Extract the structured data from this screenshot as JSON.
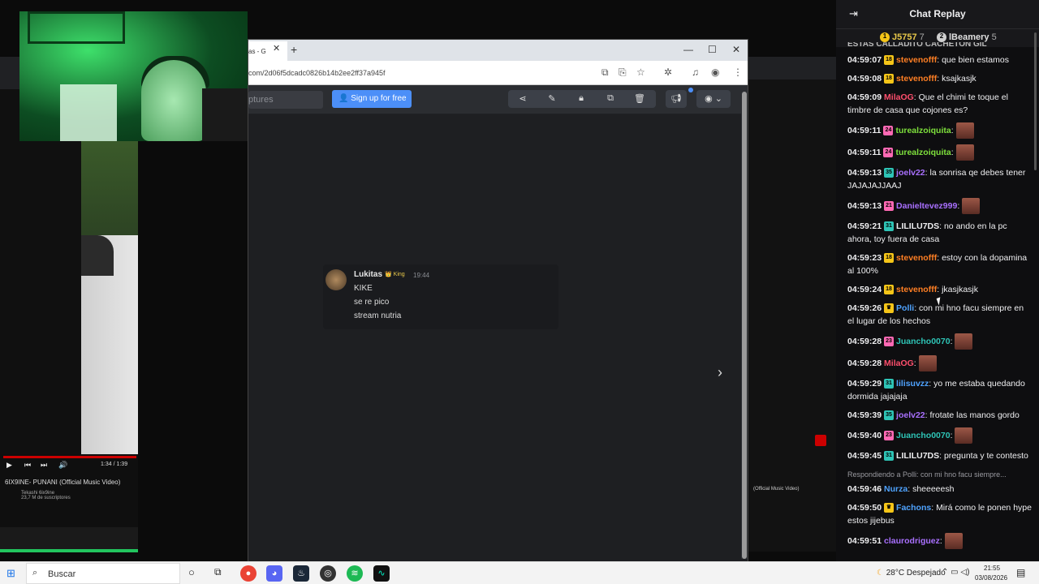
{
  "stream": {
    "left_video": {
      "title": "6IX9INE- PUNANI (Official Music Video)",
      "channel": "Tekashi 6ix9ine",
      "subs": "23,7 M de suscriptores",
      "time": "1:34 / 1:39"
    },
    "right_video": {
      "title": "(Official Music Video)"
    }
  },
  "browser": {
    "tab_title": "as - G",
    "url": "com/2d06f5dcadc0826b14b2ee2ff37a945f",
    "search_placeholder": "ptures",
    "signup_label": "Sign up for free",
    "tools": [
      "share-icon",
      "pencil-icon",
      "lock-icon",
      "duplicate-icon",
      "trash-icon"
    ],
    "message": {
      "author": "Lukitas",
      "badge": "King",
      "time": "19:44",
      "lines": [
        "KIKE",
        "se re pico",
        "stream nutria"
      ]
    }
  },
  "chat": {
    "title": "Chat Replay",
    "leaders": [
      {
        "rank": "1",
        "name": "J5757",
        "count": "7"
      },
      {
        "rank": "2",
        "name": "lBeamery",
        "count": "5"
      }
    ],
    "cut_text": "ESTAS CALLADITO CACHETON GIL",
    "messages": [
      {
        "ts": "04:59:07",
        "badge": "18",
        "badge_color": "#f5c518",
        "user": "stevenofff",
        "color": "#ff7f24",
        "text": "que bien estamos"
      },
      {
        "ts": "04:59:08",
        "badge": "18",
        "badge_color": "#f5c518",
        "user": "stevenofff",
        "color": "#ff7f24",
        "text": "ksajkasjk"
      },
      {
        "ts": "04:59:09",
        "badge": "",
        "badge_color": "",
        "user": "MilaOG",
        "color": "#ff4f6d",
        "text": "Que el chimi te toque el timbre de casa que cojones es?"
      },
      {
        "ts": "04:59:11",
        "badge": "24",
        "badge_color": "#ff69b4",
        "user": "turealzoiquita",
        "color": "#7ee03c",
        "text": "",
        "emote": true
      },
      {
        "ts": "04:59:11",
        "badge": "24",
        "badge_color": "#ff69b4",
        "user": "turealzoiquita",
        "color": "#7ee03c",
        "text": "",
        "emote": true
      },
      {
        "ts": "04:59:13",
        "badge": "35",
        "badge_color": "#2ec4b6",
        "user": "joelv22",
        "color": "#a970ff",
        "text": "la sonrisa qe debes tener JAJAJAJJAAJ"
      },
      {
        "ts": "04:59:13",
        "badge": "21",
        "badge_color": "#ff69b4",
        "user": "Danieltevez999",
        "color": "#a970ff",
        "text": "",
        "emote": true
      },
      {
        "ts": "04:59:21",
        "badge": "31",
        "badge_color": "#2ec4b6",
        "user": "LILILU7DS",
        "color": "#efeff1",
        "text": "no ando en la pc ahora, toy fuera de casa"
      },
      {
        "ts": "04:59:23",
        "badge": "18",
        "badge_color": "#f5c518",
        "user": "stevenofff",
        "color": "#ff7f24",
        "text": "estoy con la dopamina al 100%"
      },
      {
        "ts": "04:59:24",
        "badge": "18",
        "badge_color": "#f5c518",
        "user": "stevenofff",
        "color": "#ff7f24",
        "text": "jkasjkasjk"
      },
      {
        "ts": "04:59:26",
        "badge": "crown",
        "badge_color": "#f5c518",
        "user": "Polli",
        "color": "#4fa3ff",
        "text": "con mi hno facu siempre en el lugar de los hechos"
      },
      {
        "ts": "04:59:28",
        "badge": "23",
        "badge_color": "#ff69b4",
        "user": "Juancho0070",
        "color": "#2ec4b6",
        "text": "",
        "emote": true
      },
      {
        "ts": "04:59:28",
        "badge": "",
        "badge_color": "",
        "user": "MilaOG",
        "color": "#ff4f6d",
        "text": "",
        "emote": true
      },
      {
        "ts": "04:59:29",
        "badge": "31",
        "badge_color": "#2ec4b6",
        "user": "lilisuvzz",
        "color": "#4fa3ff",
        "text": "yo me estaba quedando dormida jajajaja"
      },
      {
        "ts": "04:59:39",
        "badge": "35",
        "badge_color": "#2ec4b6",
        "user": "joelv22",
        "color": "#a970ff",
        "text": "frotate las manos gordo"
      },
      {
        "ts": "04:59:40",
        "badge": "23",
        "badge_color": "#ff69b4",
        "user": "Juancho0070",
        "color": "#2ec4b6",
        "text": "",
        "emote": true
      },
      {
        "ts": "04:59:45",
        "badge": "31",
        "badge_color": "#2ec4b6",
        "user": "LILILU7DS",
        "color": "#efeff1",
        "text": "pregunta y te contesto"
      },
      {
        "ts": "04:59:46",
        "badge": "",
        "badge_color": "",
        "user": "Nurza",
        "color": "#4fa3ff",
        "text": "sheeeeesh",
        "reply": "Respondiendo a Polli: con mi hno facu siempre..."
      },
      {
        "ts": "04:59:50",
        "badge": "crown",
        "badge_color": "#f5c518",
        "user": "Fachons",
        "color": "#4fa3ff",
        "text": "Mirá como le ponen hype estos jijebus"
      },
      {
        "ts": "04:59:51",
        "badge": "",
        "badge_color": "",
        "user": "claurodriguez",
        "color": "#a970ff",
        "text": "",
        "emote": true
      }
    ]
  },
  "taskbar": {
    "search_label": "Buscar",
    "weather": "28°C  Despejado",
    "time": "21:55",
    "date": "03/08/2026"
  }
}
